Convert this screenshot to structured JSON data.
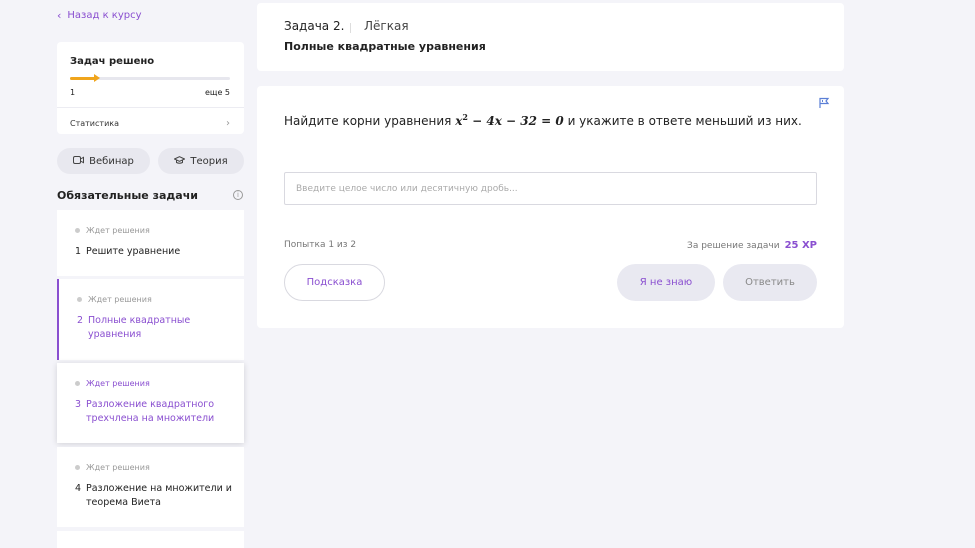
{
  "sidebar": {
    "back_link": "Назад к курсу",
    "progress": {
      "title": "Задач решено",
      "solved": "1",
      "remaining": "еще 5",
      "fraction": 0.17
    },
    "stats_link": "Статистика",
    "webinar_button": "Вебинар",
    "theory_button": "Теория",
    "mandatory_title": "Обязательные задачи",
    "tasks": [
      {
        "status": "Ждет решения",
        "number": "1",
        "title": "Решите уравнение"
      },
      {
        "status": "Ждет решения",
        "number": "2",
        "title": "Полные квадратные уравнения"
      },
      {
        "status": "Ждет решения",
        "number": "3",
        "title": "Разложение квадратного трехчлена на множители"
      },
      {
        "status": "Ждет решения",
        "number": "4",
        "title": "Разложение на множители и теорема Виета"
      }
    ]
  },
  "header": {
    "task_number": "Задача 2.",
    "difficulty": "Лёгкая",
    "title": "Полные квадратные уравнения"
  },
  "problem": {
    "question_prefix": "Найдите корни уравнения",
    "equation_var": "x",
    "equation_exp": "2",
    "equation_rest": " − 4x − 32 = 0",
    "question_suffix": "и укажите в ответе меньший из них.",
    "input_placeholder": "Введите целое число или десятичную дробь...",
    "attempt": "Попытка 1 из 2",
    "reward_label": "За решение задачи",
    "reward_xp": "25 XP",
    "hint_button": "Подсказка",
    "dont_know_button": "Я не знаю",
    "answer_button": "Ответить"
  },
  "colors": {
    "accent": "#8a4fd0",
    "progress": "#f0a51c",
    "background": "#f4f4f9"
  },
  "icons": [
    "chevron-left-icon",
    "chevron-right-icon",
    "video-icon",
    "graduation-cap-icon",
    "info-icon",
    "flag-icon"
  ]
}
